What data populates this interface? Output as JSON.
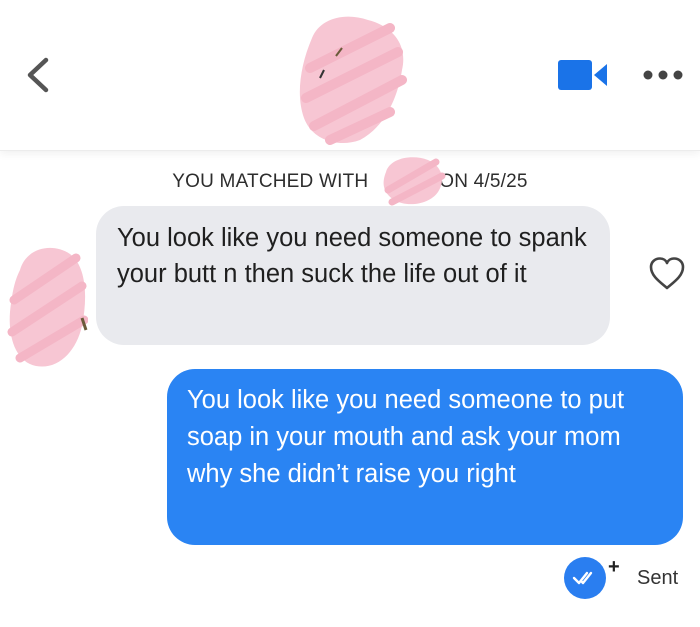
{
  "header": {
    "back_icon": "chevron-left-icon",
    "video_icon": "video-camera-icon",
    "more_icon": "ellipsis-icon",
    "accent_color": "#1a73e8"
  },
  "match_banner": {
    "prefix": "YOU MATCHED WITH",
    "suffix": "ON 4/5/25"
  },
  "messages": [
    {
      "direction": "received",
      "text": "You look like you need someone to spank your butt n then suck the life out of it",
      "bubble_color": "#e9eaee"
    },
    {
      "direction": "sent",
      "text": "You look like you need someone to put soap in your mouth and ask your mom why she didn’t raise you right",
      "bubble_color": "#2a84f3"
    }
  ],
  "status": {
    "label": "Sent",
    "plus": "+",
    "check_color": "#2a7ef0"
  },
  "redaction_color": "#f7c6d3"
}
